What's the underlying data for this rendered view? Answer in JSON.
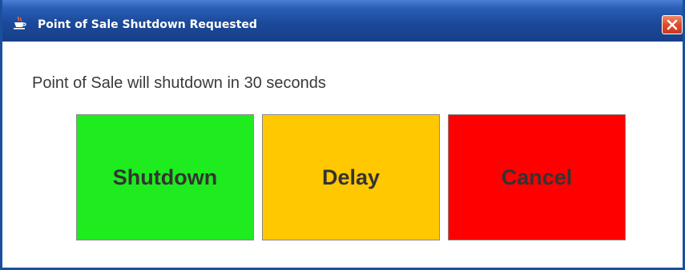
{
  "window": {
    "title": "Point of Sale Shutdown Requested"
  },
  "dialog": {
    "message": "Point of Sale will shutdown in 30 seconds"
  },
  "buttons": {
    "shutdown": {
      "label": "Shutdown",
      "color": "#1eec1e"
    },
    "delay": {
      "label": "Delay",
      "color": "#ffc800"
    },
    "cancel": {
      "label": "Cancel",
      "color": "#ff0000"
    }
  },
  "icons": {
    "app_icon": "java-coffee-cup-icon",
    "close_icon": "close-icon"
  },
  "colors": {
    "titlebar": "#1b4a9a",
    "close_button": "#df4a2a"
  }
}
